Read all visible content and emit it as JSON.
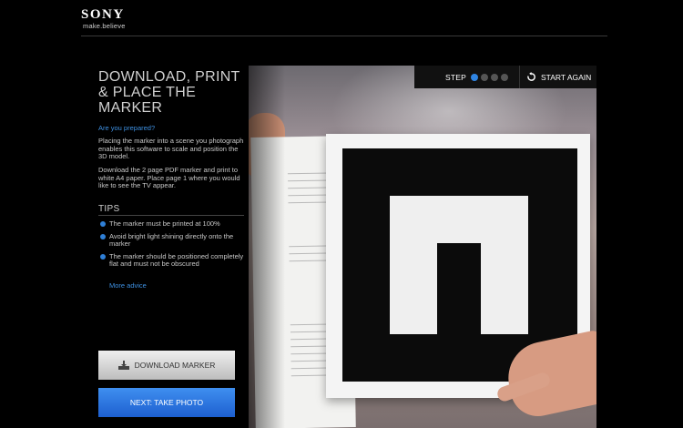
{
  "header": {
    "brand": "SONY",
    "tagline": "make.believe"
  },
  "sidebar": {
    "title": "DOWNLOAD, PRINT & PLACE THE MARKER",
    "prepared_link": "Are you prepared?",
    "paragraph1": "Placing the marker into a scene you photograph enables this software to scale and position the 3D model.",
    "paragraph2": "Download the 2 page PDF marker and print to white A4 paper.      Place page 1 where you would like to see the TV appear.",
    "tips_heading": "TIPS",
    "tips": [
      "The marker must be printed at 100%",
      "Avoid bright light shining directly onto the marker",
      "The marker should be positioned completely flat and must not be obscured"
    ],
    "more_advice_link": "More advice",
    "download_button": "DOWNLOAD MARKER",
    "next_button": "NEXT: TAKE PHOTO"
  },
  "stepbar": {
    "step_label": "STEP",
    "total_steps": 4,
    "current_step": 1,
    "start_again": "START AGAIN"
  },
  "colors": {
    "accent_blue": "#2f84e3",
    "link_blue": "#3d8fe0",
    "background": "#000000"
  },
  "icons": [
    "download-icon",
    "restart-icon"
  ]
}
